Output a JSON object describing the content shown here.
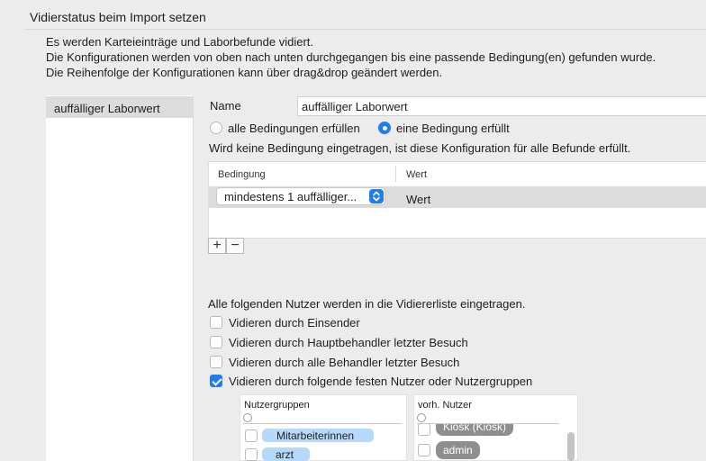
{
  "header": {
    "title": "Vidierstatus beim Import setzen"
  },
  "description": [
    "Es werden Karteieinträge und Laborbefunde vidiert.",
    "Die Konfigurationen werden von oben nach unten durchgegangen bis eine passende Bedingung(en) gefunden wurde.",
    "Die Reihenfolge der Konfigurationen kann über drag&drop geändert werden."
  ],
  "sidebar": {
    "items": [
      {
        "label": "auffälliger Laborwert",
        "selected": true
      }
    ]
  },
  "config": {
    "name_label": "Name",
    "name_value": "auffälliger Laborwert",
    "radio_all": "alle Bedingungen erfüllen",
    "radio_any": "eine Bedingung erfüllt",
    "radio_selected": "any",
    "note": "Wird keine Bedingung eingetragen, ist diese Konfiguration für alle Befunde erfüllt.",
    "table": {
      "columns": [
        "Bedingung",
        "Wert"
      ],
      "rows": [
        {
          "bedingung": "mindestens 1 auffälliger...",
          "wert": "Wert"
        }
      ]
    },
    "add_button": "+",
    "remove_button": "−"
  },
  "users": {
    "intro": "Alle folgenden Nutzer werden in die Vidiererliste eingetragen.",
    "options": [
      {
        "label": "Vidieren durch Einsender",
        "checked": false
      },
      {
        "label": "Vidieren durch Hauptbehandler letzter Besuch",
        "checked": false
      },
      {
        "label": "Vidieren durch alle Behandler letzter Besuch",
        "checked": false
      },
      {
        "label": "Vidieren durch folgende festen Nutzer oder Nutzergruppen",
        "checked": true
      }
    ],
    "groups_panel": {
      "header": "Nutzergruppen",
      "items": [
        "Mitarbeiterinnen",
        "arzt"
      ]
    },
    "users_panel": {
      "header": "vorh. Nutzer",
      "items": [
        "Kiosk (Kiosk)",
        "admin"
      ]
    }
  },
  "colors": {
    "accent": "#1f7cf5",
    "selection": "#dcdcdc",
    "tag_blue": "#b6d8fa",
    "tag_gray": "#8e8e8e"
  }
}
